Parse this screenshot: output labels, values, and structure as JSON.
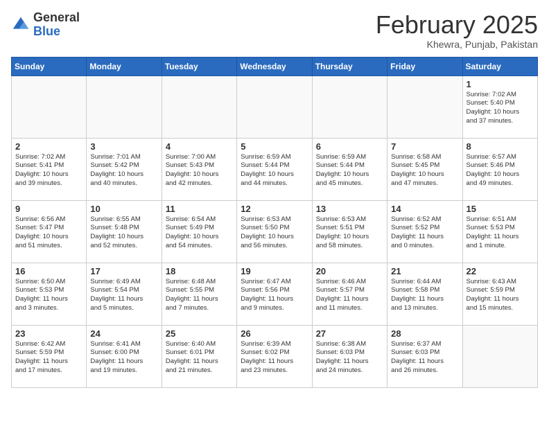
{
  "header": {
    "logo_general": "General",
    "logo_blue": "Blue",
    "month_title": "February 2025",
    "location": "Khewra, Punjab, Pakistan"
  },
  "weekdays": [
    "Sunday",
    "Monday",
    "Tuesday",
    "Wednesday",
    "Thursday",
    "Friday",
    "Saturday"
  ],
  "weeks": [
    [
      {
        "day": "",
        "info": ""
      },
      {
        "day": "",
        "info": ""
      },
      {
        "day": "",
        "info": ""
      },
      {
        "day": "",
        "info": ""
      },
      {
        "day": "",
        "info": ""
      },
      {
        "day": "",
        "info": ""
      },
      {
        "day": "1",
        "info": "Sunrise: 7:02 AM\nSunset: 5:40 PM\nDaylight: 10 hours\nand 37 minutes."
      }
    ],
    [
      {
        "day": "2",
        "info": "Sunrise: 7:02 AM\nSunset: 5:41 PM\nDaylight: 10 hours\nand 39 minutes."
      },
      {
        "day": "3",
        "info": "Sunrise: 7:01 AM\nSunset: 5:42 PM\nDaylight: 10 hours\nand 40 minutes."
      },
      {
        "day": "4",
        "info": "Sunrise: 7:00 AM\nSunset: 5:43 PM\nDaylight: 10 hours\nand 42 minutes."
      },
      {
        "day": "5",
        "info": "Sunrise: 6:59 AM\nSunset: 5:44 PM\nDaylight: 10 hours\nand 44 minutes."
      },
      {
        "day": "6",
        "info": "Sunrise: 6:59 AM\nSunset: 5:44 PM\nDaylight: 10 hours\nand 45 minutes."
      },
      {
        "day": "7",
        "info": "Sunrise: 6:58 AM\nSunset: 5:45 PM\nDaylight: 10 hours\nand 47 minutes."
      },
      {
        "day": "8",
        "info": "Sunrise: 6:57 AM\nSunset: 5:46 PM\nDaylight: 10 hours\nand 49 minutes."
      }
    ],
    [
      {
        "day": "9",
        "info": "Sunrise: 6:56 AM\nSunset: 5:47 PM\nDaylight: 10 hours\nand 51 minutes."
      },
      {
        "day": "10",
        "info": "Sunrise: 6:55 AM\nSunset: 5:48 PM\nDaylight: 10 hours\nand 52 minutes."
      },
      {
        "day": "11",
        "info": "Sunrise: 6:54 AM\nSunset: 5:49 PM\nDaylight: 10 hours\nand 54 minutes."
      },
      {
        "day": "12",
        "info": "Sunrise: 6:53 AM\nSunset: 5:50 PM\nDaylight: 10 hours\nand 56 minutes."
      },
      {
        "day": "13",
        "info": "Sunrise: 6:53 AM\nSunset: 5:51 PM\nDaylight: 10 hours\nand 58 minutes."
      },
      {
        "day": "14",
        "info": "Sunrise: 6:52 AM\nSunset: 5:52 PM\nDaylight: 11 hours\nand 0 minutes."
      },
      {
        "day": "15",
        "info": "Sunrise: 6:51 AM\nSunset: 5:53 PM\nDaylight: 11 hours\nand 1 minute."
      }
    ],
    [
      {
        "day": "16",
        "info": "Sunrise: 6:50 AM\nSunset: 5:53 PM\nDaylight: 11 hours\nand 3 minutes."
      },
      {
        "day": "17",
        "info": "Sunrise: 6:49 AM\nSunset: 5:54 PM\nDaylight: 11 hours\nand 5 minutes."
      },
      {
        "day": "18",
        "info": "Sunrise: 6:48 AM\nSunset: 5:55 PM\nDaylight: 11 hours\nand 7 minutes."
      },
      {
        "day": "19",
        "info": "Sunrise: 6:47 AM\nSunset: 5:56 PM\nDaylight: 11 hours\nand 9 minutes."
      },
      {
        "day": "20",
        "info": "Sunrise: 6:46 AM\nSunset: 5:57 PM\nDaylight: 11 hours\nand 11 minutes."
      },
      {
        "day": "21",
        "info": "Sunrise: 6:44 AM\nSunset: 5:58 PM\nDaylight: 11 hours\nand 13 minutes."
      },
      {
        "day": "22",
        "info": "Sunrise: 6:43 AM\nSunset: 5:59 PM\nDaylight: 11 hours\nand 15 minutes."
      }
    ],
    [
      {
        "day": "23",
        "info": "Sunrise: 6:42 AM\nSunset: 5:59 PM\nDaylight: 11 hours\nand 17 minutes."
      },
      {
        "day": "24",
        "info": "Sunrise: 6:41 AM\nSunset: 6:00 PM\nDaylight: 11 hours\nand 19 minutes."
      },
      {
        "day": "25",
        "info": "Sunrise: 6:40 AM\nSunset: 6:01 PM\nDaylight: 11 hours\nand 21 minutes."
      },
      {
        "day": "26",
        "info": "Sunrise: 6:39 AM\nSunset: 6:02 PM\nDaylight: 11 hours\nand 23 minutes."
      },
      {
        "day": "27",
        "info": "Sunrise: 6:38 AM\nSunset: 6:03 PM\nDaylight: 11 hours\nand 24 minutes."
      },
      {
        "day": "28",
        "info": "Sunrise: 6:37 AM\nSunset: 6:03 PM\nDaylight: 11 hours\nand 26 minutes."
      },
      {
        "day": "",
        "info": ""
      }
    ]
  ]
}
